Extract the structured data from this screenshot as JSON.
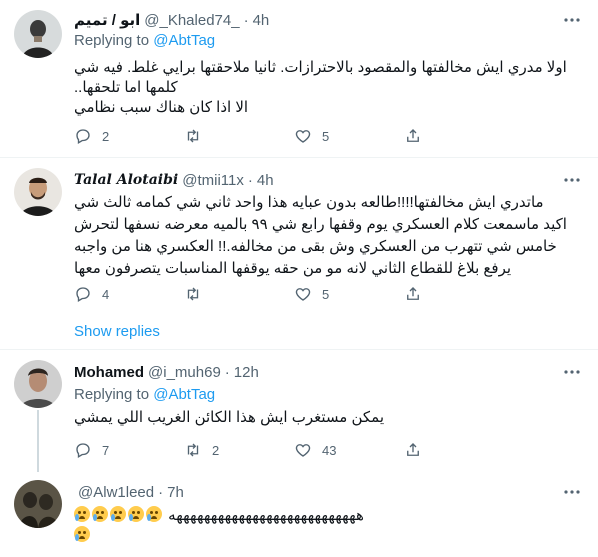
{
  "tweets": [
    {
      "name": "ابو / تميم",
      "handle": "@_Khaled74_",
      "dot": "·",
      "time": "4h",
      "replying_prefix": "Replying to",
      "replying_to": "@AbtTag",
      "lines": [
        "اولا مدري ايش مخالفتها والمقصود بالاحترازات. ثانيا ملاحقتها برايي  غلط. فيه شي",
        "كلمها اما تلحقها..",
        "الا اذا كان هناك سبب نظامي"
      ],
      "replies": "2",
      "retweets": "",
      "likes": "5"
    },
    {
      "name": "Talal Alotaibi",
      "handle": "@tmii11x",
      "dot": "·",
      "time": "4h",
      "lines": [
        "ماتدري ايش مخالفتها!!!!طالعه بدون عبايه هذا واحد ثاني شي كمامه ثالث شي",
        "اكيد ماسمعت كلام العسكري يوم وقفها رابع شي ٩٩ بالميه معرضه نسفها لتحرش",
        "خامس شي تتهرب من العسكري وش بقى من مخالفه.!! العكسري هنا من واجبه",
        "يرفع بلاغ للقطاع الثاني لانه مو من حقه يوقفها المناسبات يتصرفون معها"
      ],
      "replies": "4",
      "retweets": "",
      "likes": "5",
      "show_replies": "Show replies"
    },
    {
      "name": "Mohamed",
      "handle": "@i_muh69",
      "dot": "·",
      "time": "12h",
      "replying_prefix": "Replying to",
      "replying_to": "@AbtTag",
      "lines": [
        "يمكن مستغرب ايش هذا  الكائن الغريب اللي يمشي"
      ],
      "replies": "7",
      "retweets": "2",
      "likes": "43"
    },
    {
      "name": "",
      "handle": "@Alw1leed",
      "dot": "·",
      "time": "7h",
      "text": "هههههههههههههههههههههههههههه",
      "emoji_count": 6
    }
  ],
  "icons": {
    "reply": "reply-icon",
    "retweet": "retweet-icon",
    "like": "heart-icon",
    "share": "share-icon",
    "more": "more-icon",
    "emoji": "loudly-crying-face-emoji"
  },
  "colors": {
    "link": "#1d9bf0",
    "secondary": "#536471",
    "text": "#0f1419",
    "divider": "#eff3f4"
  }
}
